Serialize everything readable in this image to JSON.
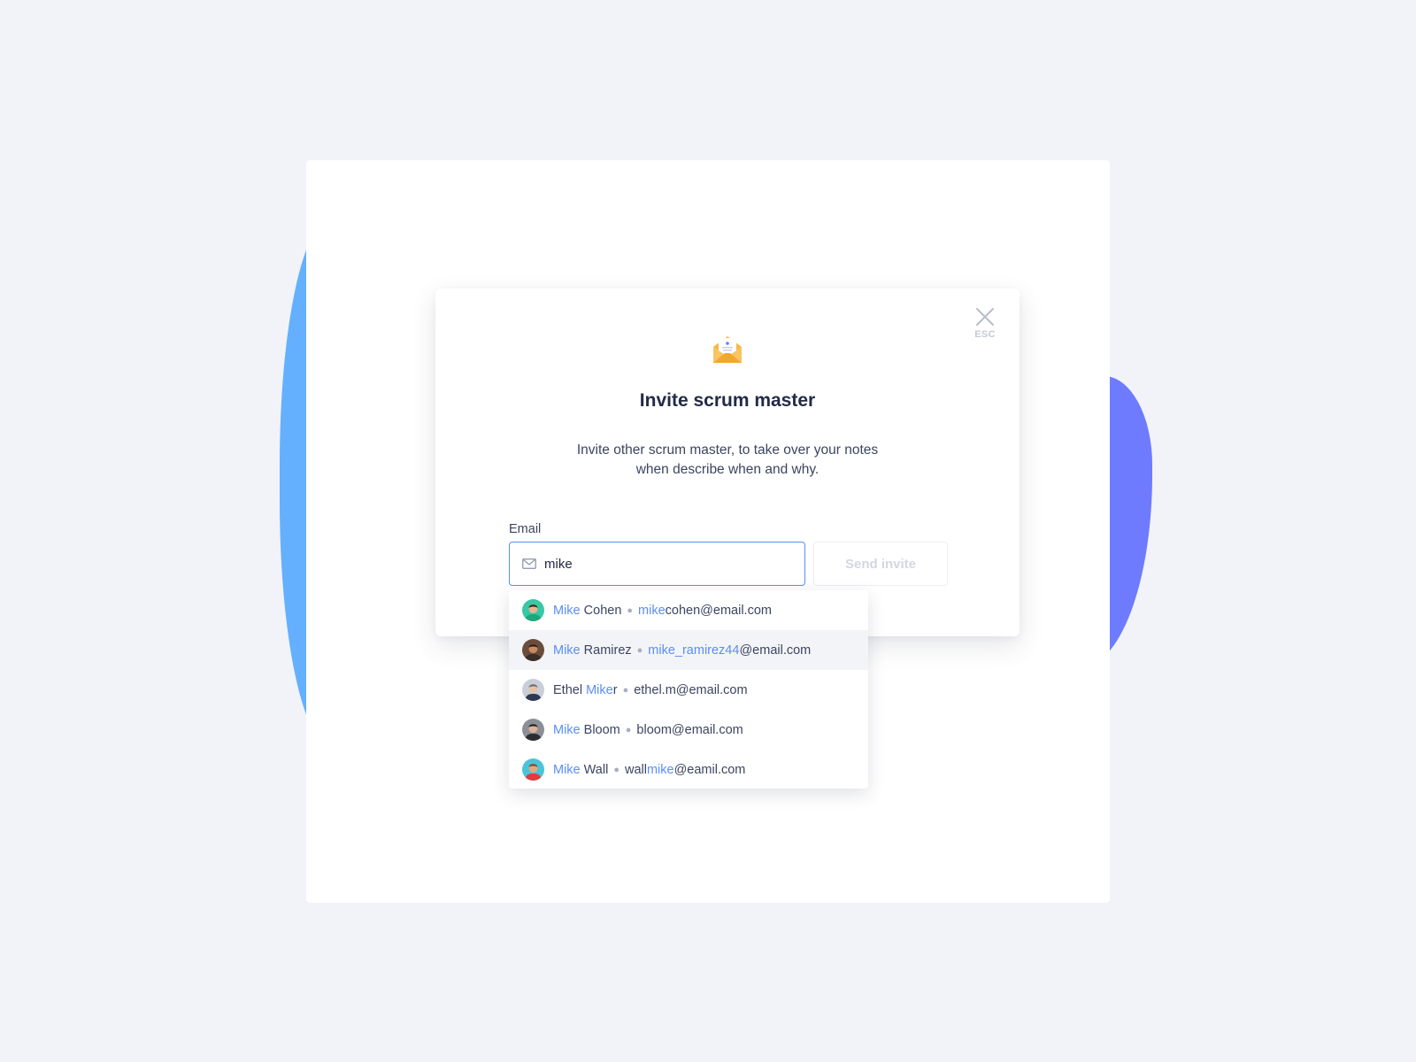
{
  "colors": {
    "background": "#f1f3f8",
    "blob_left": "#64b0fe",
    "blob_right": "#6e7bff",
    "accent": "#5a8ef5",
    "text": "#222b45"
  },
  "modal": {
    "close_icon": "close-x-icon",
    "close_hint": "ESC",
    "header_icon": "open-envelope-letter-icon",
    "title": "Invite scrum master",
    "description_line1": "Invite other scrum master, to take over your notes",
    "description_line2": "when describe when and why.",
    "email_label": "Email",
    "email_icon": "envelope-icon",
    "email_value": "mike",
    "send_button": "Send invite"
  },
  "suggestions": [
    {
      "avatar": "avatar-mike-cohen",
      "name_parts": [
        {
          "t": "Mike",
          "hl": true
        },
        {
          "t": " Cohen",
          "hl": false
        }
      ],
      "email_parts": [
        {
          "t": "mike",
          "hl": true
        },
        {
          "t": "cohen@email.com",
          "hl": false
        }
      ],
      "active": false
    },
    {
      "avatar": "avatar-mike-ramirez",
      "name_parts": [
        {
          "t": "Mike",
          "hl": true
        },
        {
          "t": " Ramirez",
          "hl": false
        }
      ],
      "email_parts": [
        {
          "t": "mike_ramirez44",
          "hl": true
        },
        {
          "t": "@email.com",
          "hl": false
        }
      ],
      "active": true
    },
    {
      "avatar": "avatar-ethel-miker",
      "name_parts": [
        {
          "t": "Ethel ",
          "hl": false
        },
        {
          "t": "Mike",
          "hl": true
        },
        {
          "t": "r",
          "hl": false
        }
      ],
      "email_parts": [
        {
          "t": "ethel.m@email.com",
          "hl": false
        }
      ],
      "active": false
    },
    {
      "avatar": "avatar-mike-bloom",
      "name_parts": [
        {
          "t": "Mike",
          "hl": true
        },
        {
          "t": " Bloom",
          "hl": false
        }
      ],
      "email_parts": [
        {
          "t": "bloom@email.com",
          "hl": false
        }
      ],
      "active": false
    },
    {
      "avatar": "avatar-mike-wall",
      "name_parts": [
        {
          "t": "Mike",
          "hl": true
        },
        {
          "t": " Wall",
          "hl": false
        }
      ],
      "email_parts": [
        {
          "t": "wall",
          "hl": false
        },
        {
          "t": "mike",
          "hl": true
        },
        {
          "t": "@eamil.com",
          "hl": false
        }
      ],
      "active": false
    }
  ]
}
